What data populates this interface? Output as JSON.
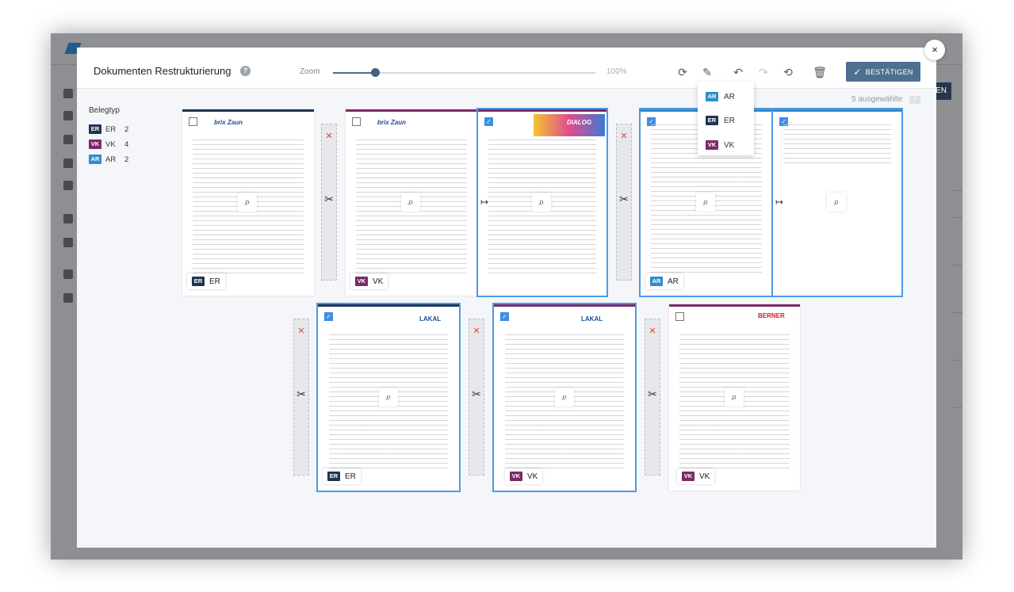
{
  "modal": {
    "title": "Dokumenten Restrukturierung",
    "help_icon": "?",
    "zoom_label": "Zoom",
    "zoom_max_label": "100%",
    "zoom_value": 0.16,
    "confirm_label": "BESTÄTIGEN",
    "selected_text": "5 ausgewählte"
  },
  "dropdown": {
    "items": [
      {
        "code": "AR"
      },
      {
        "code": "ER"
      },
      {
        "code": "VK"
      }
    ]
  },
  "legend": {
    "title": "Belegtyp",
    "items": [
      {
        "code": "ER",
        "name": "ER",
        "count": "2"
      },
      {
        "code": "VK",
        "name": "VK",
        "count": "4"
      },
      {
        "code": "AR",
        "name": "AR",
        "count": "2"
      }
    ]
  },
  "pages": [
    {
      "type": "ER",
      "logo": "brix Zaun",
      "checked": false
    },
    {
      "type": "VK",
      "logo": "brix Zaun",
      "checked": false
    },
    {
      "type": null,
      "logo": "DIALOG",
      "checked": true
    },
    {
      "type": "AR",
      "logo": "",
      "checked": true
    },
    {
      "type": null,
      "logo": "",
      "checked": true
    },
    {
      "type": "ER",
      "logo": "LAKAL",
      "checked": true
    },
    {
      "type": "VK",
      "logo": "LAKAL",
      "checked": true
    },
    {
      "type": "VK",
      "logo": "BERNER",
      "checked": false
    }
  ],
  "icons": {
    "close": "×",
    "search": "magnifier-icon",
    "scissors": "✂",
    "remove": "✕",
    "join": "↦"
  }
}
